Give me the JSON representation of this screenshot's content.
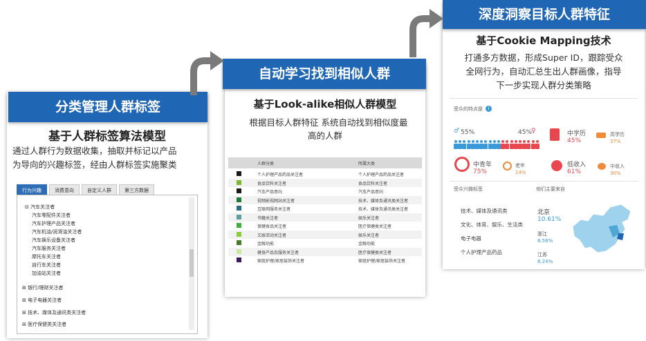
{
  "colors": {
    "header_blue": "#1f66b4",
    "arrow_gray": "#7a7a7a",
    "male_blue": "#3a9ad9",
    "female_red": "#e8474f",
    "orange": "#f08b3b"
  },
  "card1": {
    "header": "分类管理人群标签",
    "subtitle": "基于人群标签算法模型",
    "desc_line1": "通过人群行为数据收集，抽取并标记以产品",
    "desc_line2": "为导向的兴趣标签，经由人群标签实施聚类",
    "tabs": [
      "行为兴趣",
      "消费意向",
      "自定义人群",
      "第三方数据"
    ],
    "tree": [
      "⊟ 汽车关注者",
      "汽车零配件关注者",
      "汽车护理产品关注者",
      "汽车机油/润滑油关注者",
      "汽车娱乐设备关注者",
      "汽车服务关注者",
      "摩托车关注者",
      "自行车关注者",
      "加油站关注者",
      "⊞ 银行/理财关注者",
      "⊞ 电子电器关注者",
      "⊞ 技术、媒体及通讯类关注者",
      "⊞ 医疗保健类关注者"
    ]
  },
  "card2": {
    "header": "自动学习找到相似人群",
    "subtitle": "基于Look-alike相似人群模型",
    "desc_line1": "根据目标人群特征  系统自动找到相似度最",
    "desc_line2": "高的人群",
    "table_headers": [
      "人群分类",
      "所属大类"
    ],
    "rows": [
      {
        "color": "#1a1a1a",
        "name": "个人护理产品药品关注者",
        "cat": "个人护理产品药品关注者"
      },
      {
        "color": "#7ab830",
        "name": "食品饮料关注者",
        "cat": "食品饮料关注者"
      },
      {
        "color": "#1a1a1a",
        "name": "汽车产品意向",
        "cat": "汽车产品意向"
      },
      {
        "color": "#1e7a3a",
        "name": "视频影视网站关注者",
        "cat": "技术、媒体及通讯类关注者"
      },
      {
        "color": "#2a6a8a",
        "name": "互联网服务关注者",
        "cat": "技术、媒体及通讯类关注者"
      },
      {
        "color": "#5aa0a0",
        "name": "书籍关注者",
        "cat": "娱乐关注者"
      },
      {
        "color": "#3db03d",
        "name": "保健食品关注者",
        "cat": "医疗保健类关注者"
      },
      {
        "color": "#8acc3a",
        "name": "文娱活动关注者",
        "cat": "娱乐关注者"
      },
      {
        "color": "#4a7a2a",
        "name": "金融功能",
        "cat": "金融功能"
      },
      {
        "color": "#c8e8a0",
        "name": "健身产品及服务关注者",
        "cat": "医疗保健类关注者"
      },
      {
        "color": "#3a1a5a",
        "name": "家庭护理/家居装饰关注者",
        "cat": "家庭护理/家居装饰关注者"
      }
    ]
  },
  "card3": {
    "header": "深度洞察目标人群特征",
    "subtitle": "基于Cookie Mapping技术",
    "desc_line1": "打通多方数据，形成Super  ID，跟踪受众",
    "desc_line2": "全网行为，自动汇总生出人群画像，指导",
    "desc_line3": "下一步实现人群分类策略",
    "audience_label": "受众的特点是",
    "male_pct": "55%",
    "female_pct": "45%",
    "edu_main": "中学历",
    "edu_main_pct": "45%",
    "edu_high": "高学历",
    "edu_high_pct": "37%",
    "age_main": "中青年",
    "age_main_pct": "75%",
    "age_old": "老年",
    "age_old_pct": "14%",
    "income_low": "低收入",
    "income_low_pct": "61%",
    "income_mid": "中收入",
    "income_mid_pct": "30%",
    "interest_label": "受众兴趣标签",
    "region_label": "他们主要来自",
    "interests": [
      "技术、媒体及通讯类",
      "文化、体育、娱乐、生活类",
      "电子电器",
      "个人护理产品药品"
    ],
    "regions": [
      {
        "name": "北京",
        "pct": "10.61%"
      },
      {
        "name": "浙江",
        "pct": "8.56%"
      },
      {
        "name": "江苏",
        "pct": "8.24%"
      }
    ]
  }
}
